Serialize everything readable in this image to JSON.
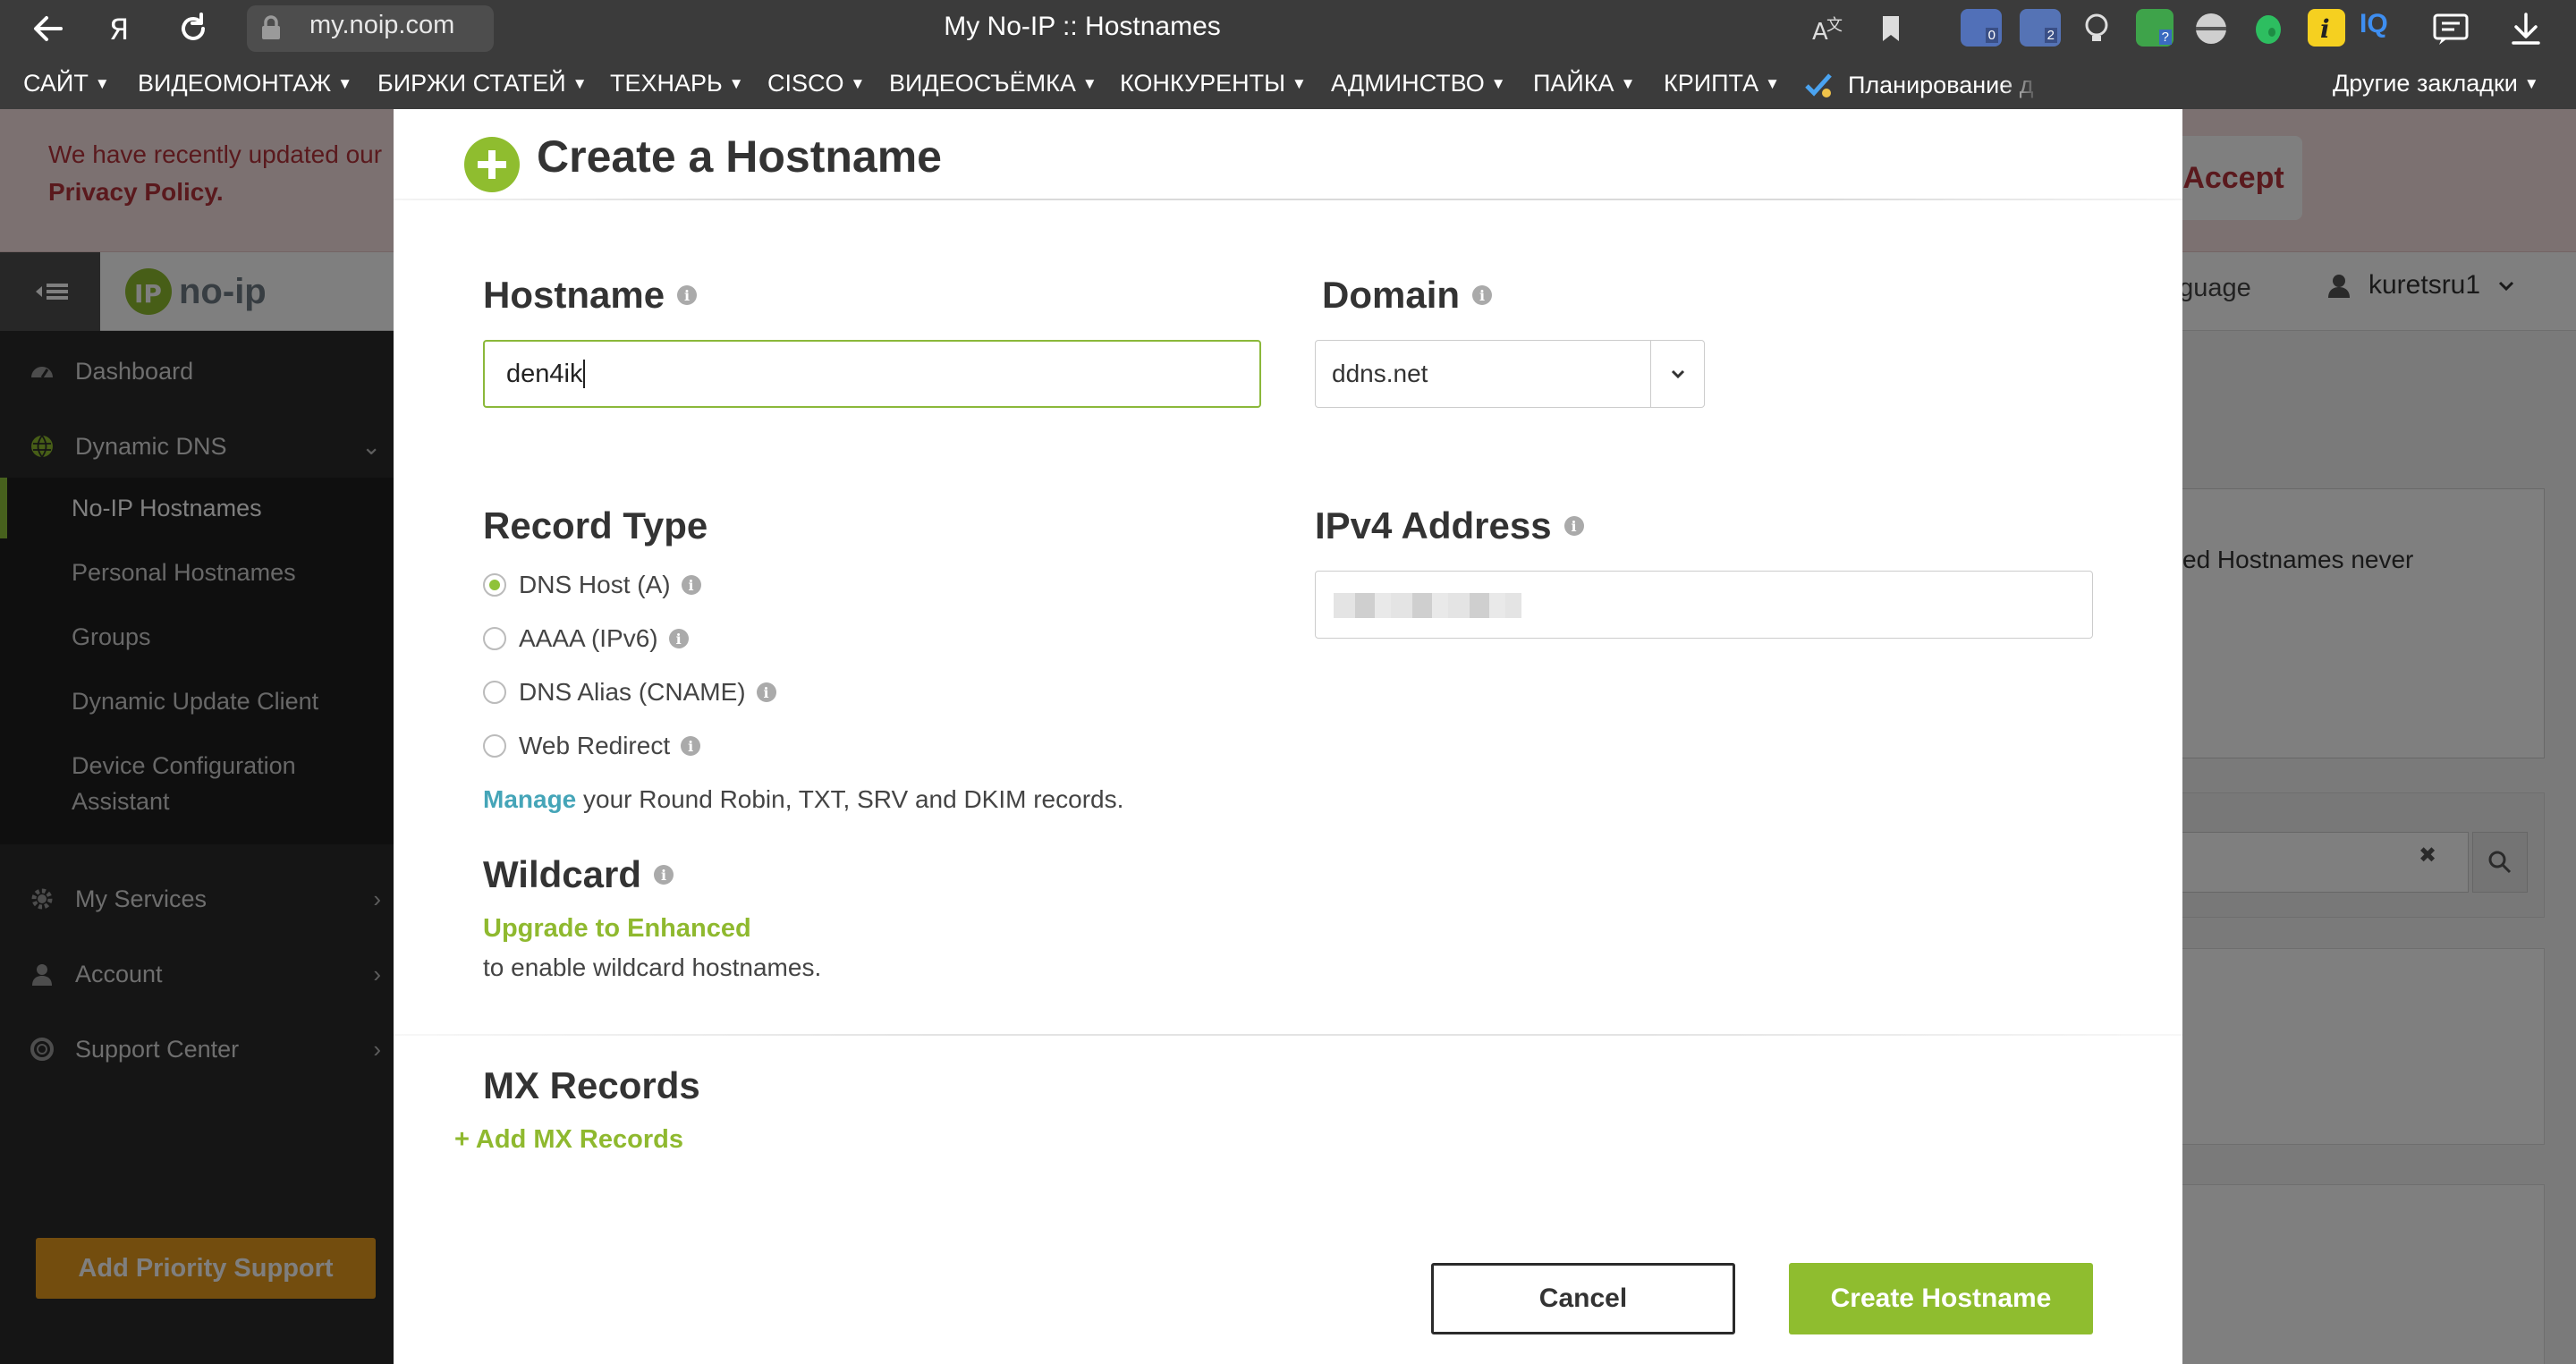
{
  "browser": {
    "url": "my.noip.com",
    "window_title": "My No-IP :: Hostnames",
    "ext_badges": [
      "0",
      "2",
      "?"
    ],
    "ext_iq_label": "IQ"
  },
  "bookmarks": {
    "items": [
      "САЙТ",
      "ВИДЕОМОНТАЖ",
      "БИРЖИ СТАТЕЙ",
      "ТЕХНАРЬ",
      "CISCO",
      "ВИДЕОСЪЁМКА",
      "КОНКУРЕНТЫ",
      "АДМИНСТВО",
      "ПАЙКА",
      "КРИПТА"
    ],
    "planning": "Планирование д",
    "other": "Другие закладки"
  },
  "privacy_banner": {
    "text": "We have recently updated our",
    "link": "Privacy Policy.",
    "accept_label": "Accept"
  },
  "topbar": {
    "logo_text": "no-ip",
    "language_label": "nguage",
    "username": "kuretsru1"
  },
  "sidebar": {
    "dashboard": "Dashboard",
    "dynamic_dns": "Dynamic DNS",
    "sub_items": [
      "No-IP Hostnames",
      "Personal Hostnames",
      "Groups",
      "Dynamic Update Client",
      "Device Configuration",
      "Assistant"
    ],
    "my_services": "My Services",
    "account": "Account",
    "support_center": "Support Center",
    "priority_button": "Add Priority Support"
  },
  "background": {
    "notice_fragment": "ed Hostnames never",
    "clear_search_icon": "✖"
  },
  "modal": {
    "title": "Create a Hostname",
    "hostname_label": "Hostname",
    "hostname_value": "den4ik",
    "domain_label": "Domain",
    "domain_value": "ddns.net",
    "record_type_label": "Record Type",
    "record_types": [
      {
        "label": "DNS Host (A)",
        "selected": true
      },
      {
        "label": "AAAA (IPv6)",
        "selected": false
      },
      {
        "label": "DNS Alias (CNAME)",
        "selected": false
      },
      {
        "label": "Web Redirect",
        "selected": false
      }
    ],
    "ipv4_label": "IPv4 Address",
    "manage_link": "Manage",
    "manage_text": " your Round Robin, TXT, SRV and DKIM records.",
    "wildcard_label": "Wildcard",
    "upgrade_link": "Upgrade to Enhanced",
    "wildcard_note": "to enable wildcard hostnames.",
    "mx_label": "MX Records",
    "add_mx_label": "Add MX Records",
    "cancel_label": "Cancel",
    "create_label": "Create Hostname"
  },
  "colors": {
    "accent_green": "#8fbd2f",
    "link_teal": "#45a5b8",
    "privacy_red": "#b5333a",
    "priority_orange": "#e69a1c"
  }
}
